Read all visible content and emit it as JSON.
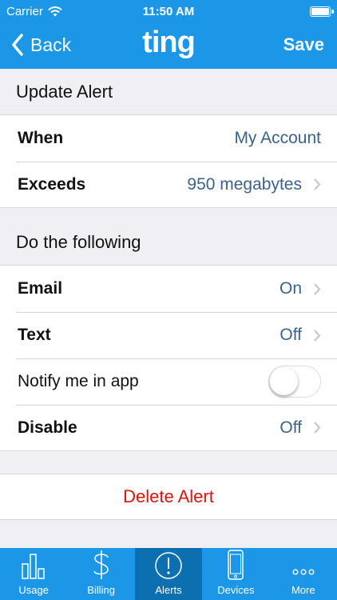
{
  "status_bar": {
    "carrier": "Carrier",
    "time": "11:50 AM",
    "wifi_icon": "wifi-icon",
    "battery_icon": "battery-icon"
  },
  "nav": {
    "back_label": "Back",
    "brand": "ting",
    "save_label": "Save",
    "background": "#1c96e6"
  },
  "update_section": {
    "header": "Update Alert",
    "rows": [
      {
        "label": "When",
        "value": "My Account"
      },
      {
        "label": "Exceeds",
        "value": "950 megabytes"
      }
    ]
  },
  "actions_section": {
    "header": "Do the following",
    "email": {
      "label": "Email",
      "value": "On"
    },
    "text": {
      "label": "Text",
      "value": "Off"
    },
    "notify": {
      "label": "Notify me in app",
      "enabled": false
    },
    "disable": {
      "label": "Disable",
      "value": "Off"
    }
  },
  "delete_label": "Delete Alert",
  "colors": {
    "accent": "#1c96e6",
    "tab_active": "#0c6fb0",
    "value_text": "#3d6289",
    "destructive": "#e3140c"
  },
  "tabs": [
    {
      "label": "Usage",
      "icon": "bar-chart-icon",
      "active": false
    },
    {
      "label": "Billing",
      "icon": "dollar-icon",
      "active": false
    },
    {
      "label": "Alerts",
      "icon": "alert-icon",
      "active": true
    },
    {
      "label": "Devices",
      "icon": "phone-icon",
      "active": false
    },
    {
      "label": "More",
      "icon": "more-icon",
      "active": false
    }
  ]
}
